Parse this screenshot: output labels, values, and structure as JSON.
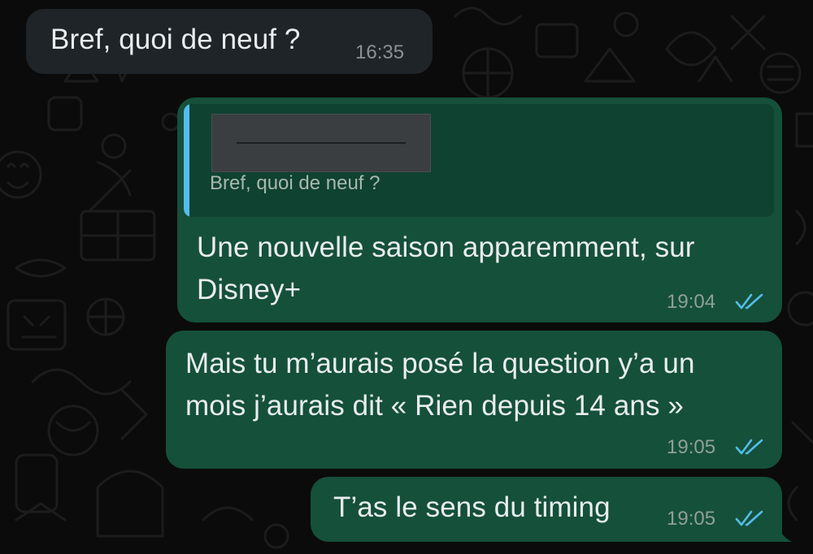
{
  "chat": {
    "messages": [
      {
        "direction": "incoming",
        "text": "Bref, quoi de neuf ?",
        "time": "16:35"
      },
      {
        "direction": "outgoing",
        "reply_to": {
          "sender_redacted": true,
          "text": "Bref, quoi de neuf ?"
        },
        "lines": [
          "Une nouvelle saison apparemment, sur",
          "Disney+"
        ],
        "time": "19:04",
        "status": "read"
      },
      {
        "direction": "outgoing",
        "lines": [
          "Mais tu m’aurais posé la question y’a un",
          "mois j’aurais dit « Rien depuis 14 ans »"
        ],
        "time": "19:05",
        "status": "read"
      },
      {
        "direction": "outgoing",
        "text": "T’as le sens du timing",
        "time": "19:05",
        "status": "read"
      }
    ]
  },
  "colors": {
    "background": "#0b0b0b",
    "incoming_bubble": "#1f2428",
    "outgoing_bubble": "#15503a",
    "quote_background": "#0f4230",
    "quote_bar": "#53bdeb",
    "read_ticks": "#53bdeb"
  },
  "icons": {
    "read_status": "double-check-icon"
  }
}
